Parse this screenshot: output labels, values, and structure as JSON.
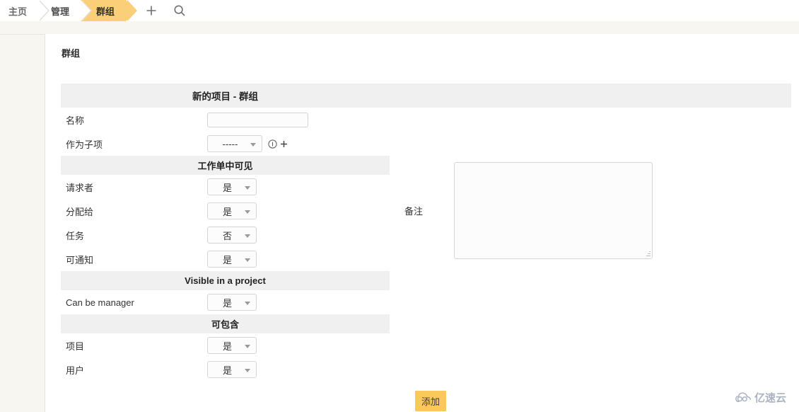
{
  "breadcrumb": {
    "items": [
      {
        "label": "主页",
        "active": false,
        "name": "breadcrumb-home"
      },
      {
        "label": "管理",
        "active": false,
        "name": "breadcrumb-admin"
      },
      {
        "label": "群组",
        "active": true,
        "name": "breadcrumb-groups"
      }
    ],
    "icons": [
      {
        "name": "plus-icon",
        "label": "plus"
      },
      {
        "name": "search-icon",
        "label": "search"
      }
    ]
  },
  "page": {
    "title": "群组",
    "form_heading": "新的项目 - 群组"
  },
  "form": {
    "name_row": {
      "label": "名称",
      "value": "",
      "placeholder": ""
    },
    "parent_row": {
      "label": "作为子项",
      "selected": "-----",
      "options": [
        "-----"
      ],
      "info_icon": "info-circle-icon",
      "add_icon": "plus-small-icon"
    },
    "sections": [
      {
        "heading": "工作单中可见",
        "rows": [
          {
            "label": "请求者",
            "value": "是"
          },
          {
            "label": "分配给",
            "value": "是"
          },
          {
            "label": "任务",
            "value": "否"
          },
          {
            "label": "可通知",
            "value": "是"
          }
        ]
      },
      {
        "heading": "Visible in a project",
        "rows": [
          {
            "label": "Can be manager",
            "value": "是"
          }
        ]
      },
      {
        "heading": "可包含",
        "rows": [
          {
            "label": "项目",
            "value": "是"
          },
          {
            "label": "用户",
            "value": "是"
          }
        ]
      }
    ],
    "yes_no_options": [
      "是",
      "否"
    ],
    "note": {
      "label": "备注",
      "value": "",
      "placeholder": ""
    },
    "submit_label": "添加"
  },
  "watermark": {
    "text": "亿速云",
    "icon": "cloud-logo-icon"
  },
  "colors": {
    "accent": "#fbcf78",
    "button": "#fbc85a",
    "section_bar": "#f0f0f0",
    "page_bg": "#f7f6f1",
    "watermark": "#a7afc0"
  }
}
